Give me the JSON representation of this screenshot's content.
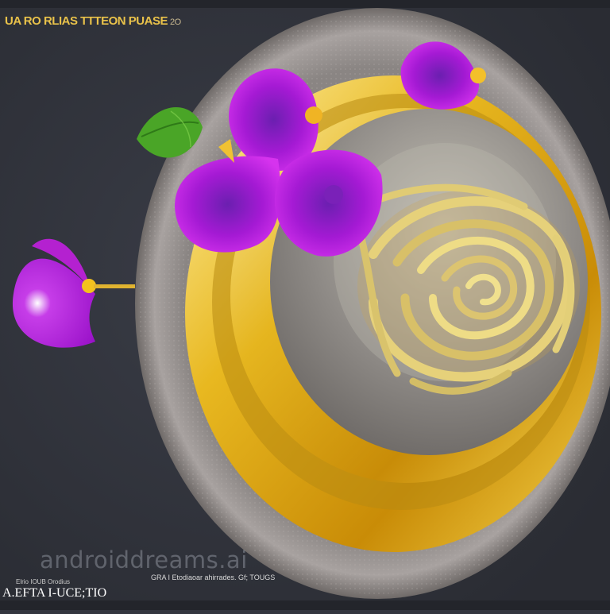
{
  "top_title": {
    "text": "UA RO RLIAS TTTEON PUASE",
    "number": "2O"
  },
  "watermark": "androiddreams.ai",
  "bottom_captions": {
    "small": "Elrio IOUB Orodius",
    "large": "A.EFTA I-UCE;TIO",
    "middle": "GRA I Etodiaoar ahirrades. Gf; TOUGS"
  },
  "colors": {
    "background": "#33363f",
    "plate_rim": "#a09b98",
    "gold": "#e8b820",
    "pasta": "#e6d17a",
    "petal": "#b116d8",
    "leaf": "#4aa527"
  }
}
